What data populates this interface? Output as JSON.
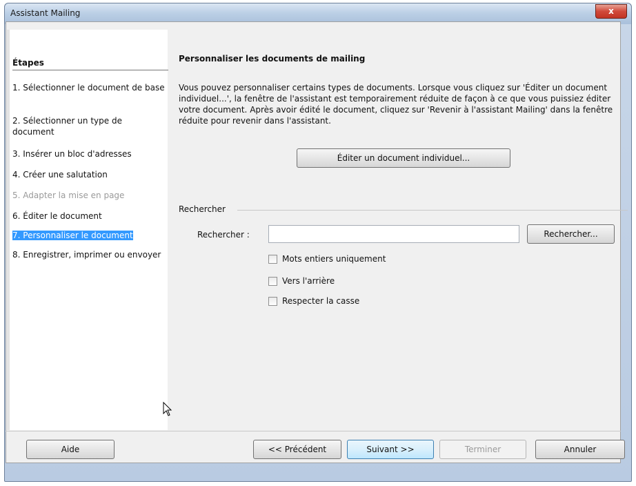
{
  "window": {
    "title": "Assistant Mailing",
    "close_label": "x"
  },
  "steps": {
    "header": "Étapes",
    "items": [
      {
        "label": "1. Sélectionner le document de base",
        "state": "normal"
      },
      {
        "label": "2. Sélectionner un type de document",
        "state": "normal"
      },
      {
        "label": "3. Insérer un bloc d'adresses",
        "state": "normal"
      },
      {
        "label": "4. Créer une salutation",
        "state": "normal"
      },
      {
        "label": "5. Adapter la mise en page",
        "state": "disabled"
      },
      {
        "label": "6. Éditer le document",
        "state": "normal"
      },
      {
        "label": "7. Personnaliser le document",
        "state": "selected"
      },
      {
        "label": "8. Enregistrer, imprimer ou envoyer",
        "state": "normal"
      }
    ]
  },
  "main": {
    "title": "Personnaliser les documents de mailing",
    "description": "Vous pouvez personnaliser certains types de documents. Lorsque vous cliquez sur 'Éditer un document individuel...', la fenêtre de l'assistant est temporairement réduite de façon à ce que vous puissiez éditer votre document. Après avoir édité le document, cliquez sur 'Revenir à l'assistant Mailing' dans la fenêtre réduite pour revenir dans l'assistant.",
    "edit_button": "Éditer un document individuel..."
  },
  "search": {
    "group_label": "Rechercher",
    "field_label": "Rechercher :",
    "value": "",
    "button": "Rechercher...",
    "options": [
      {
        "label": "Mots entiers uniquement",
        "checked": false
      },
      {
        "label": "Vers l'arrière",
        "checked": false
      },
      {
        "label": "Respecter la casse",
        "checked": false
      }
    ]
  },
  "footer": {
    "help": "Aide",
    "previous": "<< Précédent",
    "next": "Suivant >>",
    "finish": "Terminer",
    "cancel": "Annuler"
  },
  "colors": {
    "selection": "#3399ff",
    "disabled_text": "#9a9a9a"
  }
}
